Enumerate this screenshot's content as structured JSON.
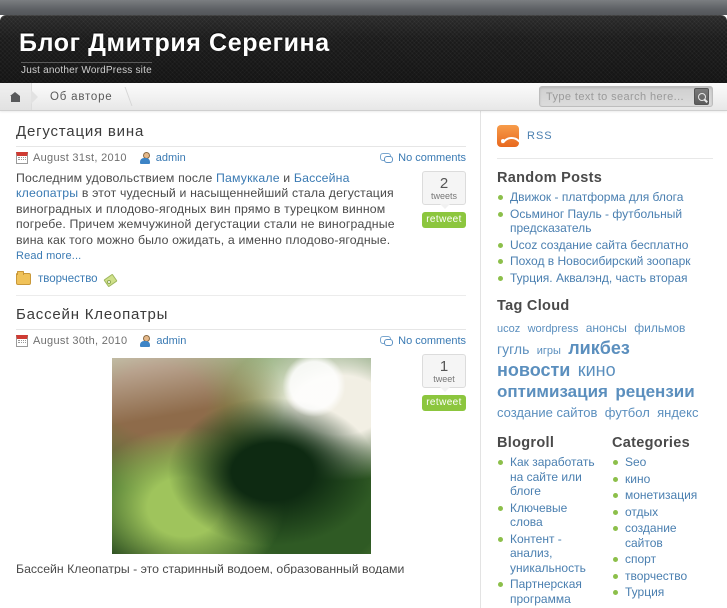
{
  "header": {
    "title": "Блог Дмитрия Серегина",
    "tagline": "Just another WordPress site"
  },
  "nav": {
    "home_icon": "home-icon",
    "items": [
      {
        "label": "Об авторе"
      }
    ]
  },
  "search": {
    "placeholder": "Type text to search here...",
    "value": "",
    "icon": "search-icon"
  },
  "posts": [
    {
      "title": "Дегустация вина",
      "date": "August 31st, 2010",
      "author": "admin",
      "comments": "No comments",
      "text_before_link1": "Последним удовольствием после ",
      "link1": "Памуккале",
      "text_mid": " и ",
      "link2": "Бассейна клеопатры",
      "text_after": " в этот чудесный и насыщеннейший стала дегустация виноградных и плодово-ягодных вин прямо в турецком винном погребе. Причем жемчужиной дегустации стали не виноградные вина как того можно было ожидать, а именно плодово-ягодные. ",
      "read_more": "Read more...",
      "tweet_count": "2",
      "tweet_word": "tweets",
      "retweet_label": "retweet",
      "category": "творчество"
    },
    {
      "title": "Бассейн Клеопатры",
      "date": "August 30th, 2010",
      "author": "admin",
      "comments": "No comments",
      "tweet_count": "1",
      "tweet_word": "tweet",
      "retweet_label": "retweet",
      "photo_alt": "Бассейн Клеопатры — пруд с растениями",
      "caption": "Бассейн Клеопатры - это старинный водоем, образованный водами высокими"
    }
  ],
  "sidebar": {
    "rss_label": "RSS",
    "random_posts": {
      "title": "Random Posts",
      "items": [
        {
          "label": "Движок - платформа для блога"
        },
        {
          "label": "Осьминог Пауль - футбольный предсказатель"
        },
        {
          "label": "Ucoz создание сайта бесплатно"
        },
        {
          "label": "Поход в Новосибирский зоопарк"
        },
        {
          "label": "Турция. Аквалэнд, часть вторая"
        }
      ]
    },
    "tag_cloud": {
      "title": "Tag Cloud",
      "tags": [
        {
          "label": "ucoz",
          "size": 11
        },
        {
          "label": "wordpress",
          "size": 11
        },
        {
          "label": "анонсы",
          "size": 12
        },
        {
          "label": "фильмов",
          "size": 12
        },
        {
          "label": "гугль",
          "size": 14
        },
        {
          "label": "игры",
          "size": 11
        },
        {
          "label": "ликбез",
          "size": 18
        },
        {
          "label": "новости",
          "size": 18
        },
        {
          "label": "кино",
          "size": 18
        },
        {
          "label": "оптимизация",
          "size": 17
        },
        {
          "label": "рецензии",
          "size": 17
        },
        {
          "label": "создание сайтов",
          "size": 13
        },
        {
          "label": "футбол",
          "size": 13
        },
        {
          "label": "яндекс",
          "size": 13
        }
      ]
    },
    "blogroll": {
      "title": "Blogroll",
      "items": [
        {
          "label": "Как заработать на сайте или блоге"
        },
        {
          "label": "Ключевые слова"
        },
        {
          "label": "Контент - анализ, уникальность"
        },
        {
          "label": "Партнерская программа"
        }
      ]
    },
    "categories": {
      "title": "Categories",
      "items": [
        {
          "label": "Seo"
        },
        {
          "label": "кино"
        },
        {
          "label": "монетизация"
        },
        {
          "label": "отдых"
        },
        {
          "label": "создание сайтов"
        },
        {
          "label": "спорт"
        },
        {
          "label": "творчество"
        },
        {
          "label": "Турция"
        }
      ]
    }
  },
  "colors": {
    "link": "#4a7fb0",
    "bullet": "#8cbf4a",
    "retweet": "#8cc63e",
    "rss": "#e8681e",
    "header_bg": "#1b1b1b"
  }
}
